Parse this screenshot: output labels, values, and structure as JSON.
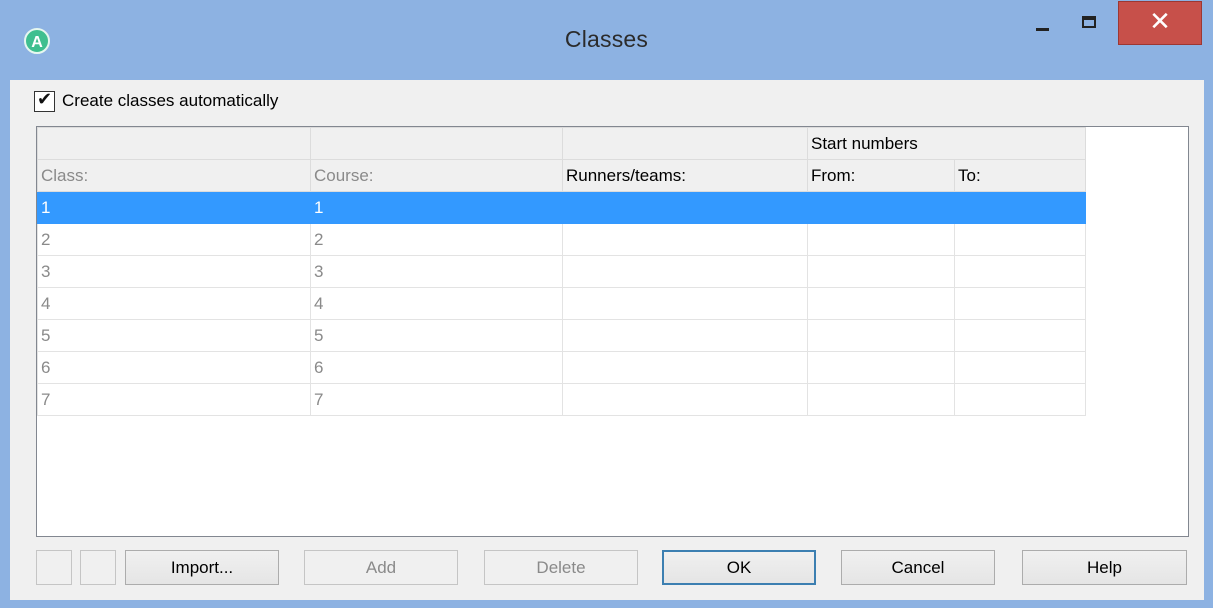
{
  "window": {
    "title": "Classes",
    "icon": "A",
    "close_glyph": "✕"
  },
  "checkbox": {
    "label": "Create classes automatically",
    "checked": true
  },
  "grid": {
    "group_header": "Start numbers",
    "columns": [
      "Class:",
      "Course:",
      "Runners/teams:",
      "From:",
      "To:"
    ],
    "rows": [
      {
        "class": "1",
        "course": "1",
        "runners": "",
        "from": "",
        "to": "",
        "selected": true
      },
      {
        "class": "2",
        "course": "2",
        "runners": "",
        "from": "",
        "to": ""
      },
      {
        "class": "3",
        "course": "3",
        "runners": "",
        "from": "",
        "to": ""
      },
      {
        "class": "4",
        "course": "4",
        "runners": "",
        "from": "",
        "to": ""
      },
      {
        "class": "5",
        "course": "5",
        "runners": "",
        "from": "",
        "to": ""
      },
      {
        "class": "6",
        "course": "6",
        "runners": "",
        "from": "",
        "to": ""
      },
      {
        "class": "7",
        "course": "7",
        "runners": "",
        "from": "",
        "to": ""
      }
    ]
  },
  "buttons": {
    "import": "Import...",
    "add": "Add",
    "delete": "Delete",
    "ok": "OK",
    "cancel": "Cancel",
    "help": "Help"
  },
  "colors": {
    "titlebar": "#8db2e2",
    "close": "#c7504a",
    "selection": "#3399ff"
  }
}
